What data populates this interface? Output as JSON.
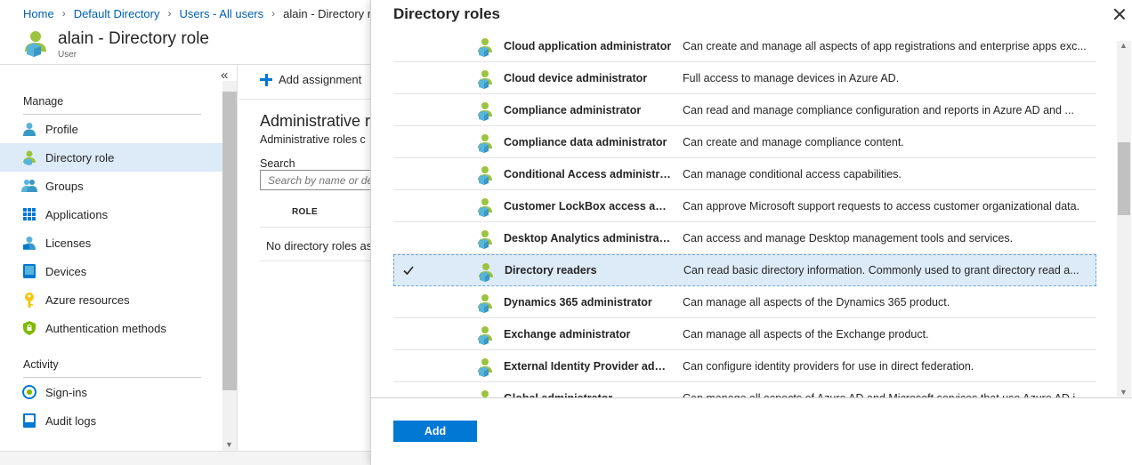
{
  "breadcrumb": {
    "items": [
      "Home",
      "Default Directory",
      "Users - All users"
    ],
    "current": "alain - Directory r"
  },
  "header": {
    "title": "alain - Directory role",
    "subtitle": "User"
  },
  "leftnav": {
    "collapse_glyph": "«",
    "sections": [
      {
        "label": "Manage"
      },
      {
        "label": "Activity"
      }
    ],
    "items": [
      {
        "label": "Profile",
        "icon": "user-icon"
      },
      {
        "label": "Directory role",
        "icon": "directory-role-icon",
        "active": true
      },
      {
        "label": "Groups",
        "icon": "groups-icon"
      },
      {
        "label": "Applications",
        "icon": "applications-icon"
      },
      {
        "label": "Licenses",
        "icon": "licenses-icon"
      },
      {
        "label": "Devices",
        "icon": "devices-icon"
      },
      {
        "label": "Azure resources",
        "icon": "key-icon"
      },
      {
        "label": "Authentication methods",
        "icon": "shield-icon"
      },
      {
        "label": "Sign-ins",
        "icon": "sign-in-icon"
      },
      {
        "label": "Audit logs",
        "icon": "audit-log-icon"
      }
    ]
  },
  "content": {
    "add_assignment": "Add assignment",
    "title": "Administrative ro",
    "description": "Administrative roles c",
    "search_label": "Search",
    "search_placeholder": "Search by name or de",
    "table_header_role": "ROLE",
    "empty_message": "No directory roles as"
  },
  "panel": {
    "title": "Directory roles",
    "add_button": "Add",
    "roles": [
      {
        "name": "Cloud application administrator",
        "description": "Can create and manage all aspects of app registrations and enterprise apps exc...",
        "selected": false
      },
      {
        "name": "Cloud device administrator",
        "description": "Full access to manage devices in Azure AD.",
        "selected": false
      },
      {
        "name": "Compliance administrator",
        "description": "Can read and manage compliance configuration and reports in Azure AD and ...",
        "selected": false
      },
      {
        "name": "Compliance data administrator",
        "description": "Can create and manage compliance content.",
        "selected": false
      },
      {
        "name": "Conditional Access administra...",
        "description": "Can manage conditional access capabilities.",
        "selected": false
      },
      {
        "name": "Customer LockBox access app...",
        "description": "Can approve Microsoft support requests to access customer organizational data.",
        "selected": false
      },
      {
        "name": "Desktop Analytics administrator",
        "description": "Can access and manage Desktop management tools and services.",
        "selected": false
      },
      {
        "name": "Directory readers",
        "description": "Can read basic directory information. Commonly used to grant directory read a...",
        "selected": true
      },
      {
        "name": "Dynamics 365 administrator",
        "description": "Can manage all aspects of the Dynamics 365 product.",
        "selected": false
      },
      {
        "name": "Exchange administrator",
        "description": "Can manage all aspects of the Exchange product.",
        "selected": false
      },
      {
        "name": "External Identity Provider adm...",
        "description": "Can configure identity providers for use in direct federation.",
        "selected": false
      },
      {
        "name": "Global administrator",
        "description": "Can manage all aspects of Azure AD and Microsoft services that use Azure AD i...",
        "selected": false
      }
    ]
  },
  "colors": {
    "accent": "#0078d4",
    "link": "#0060b3",
    "selected_row": "#ddebf8",
    "role_icon_green": "#9bc33d",
    "role_icon_blue": "#59b4d9"
  }
}
